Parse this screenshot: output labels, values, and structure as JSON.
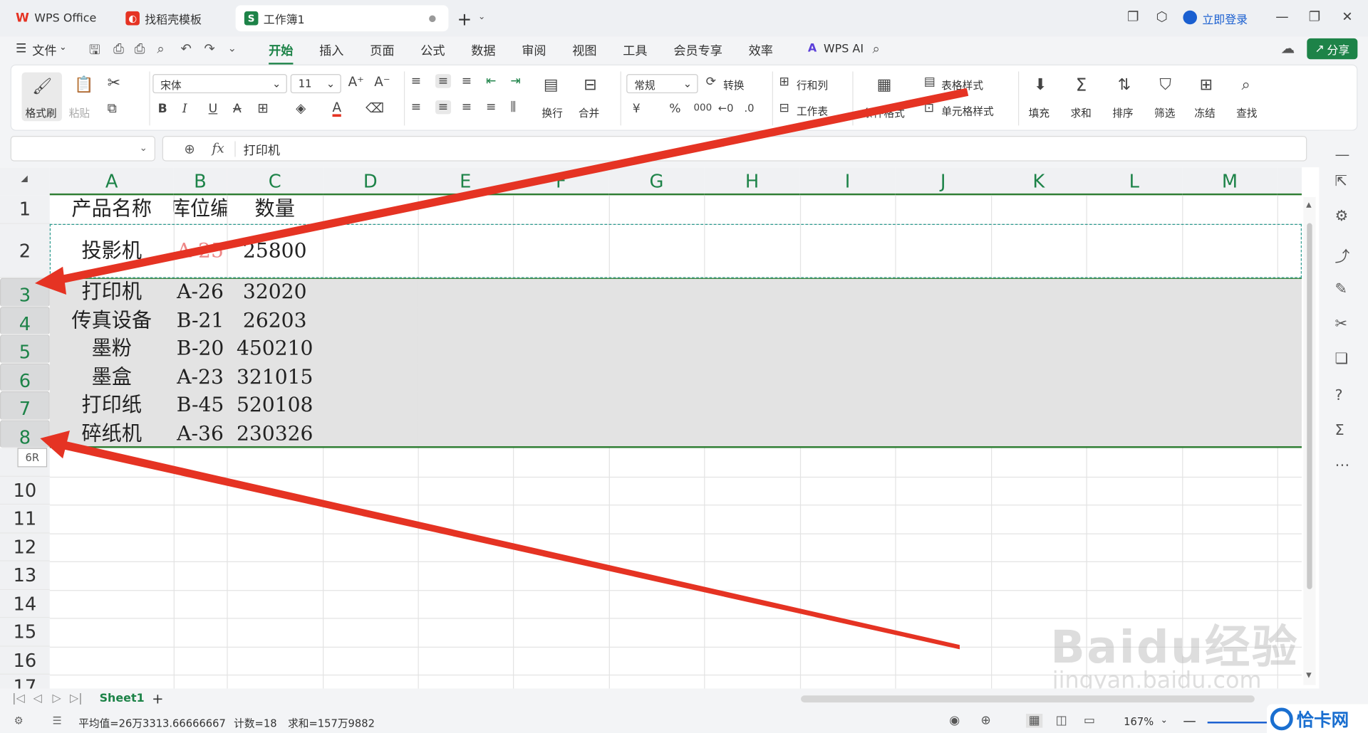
{
  "tabs": [
    {
      "label": "WPS Office",
      "icon": "wps-logo-icon"
    },
    {
      "label": "找稻壳模板",
      "icon": "docer-icon"
    },
    {
      "label": "工作簿1",
      "icon": "spreadsheet-s-icon",
      "badge": "S"
    }
  ],
  "top_right": {
    "login": "立即登录"
  },
  "menu": {
    "file": "文件",
    "items": [
      "开始",
      "插入",
      "页面",
      "公式",
      "数据",
      "审阅",
      "视图",
      "工具",
      "会员专享",
      "效率"
    ],
    "wps_ai": "WPS AI",
    "share": "分享"
  },
  "ribbon": {
    "format_painter": "格式刷",
    "paste": "粘贴",
    "font_name": "宋体",
    "font_size": "11",
    "wrap": "换行",
    "merge": "合并",
    "number_format": "常规",
    "convert": "转换",
    "row_col": "行和列",
    "worksheet": "工作表",
    "cond_format": "条件格式",
    "table_style": "表格样式",
    "cell_style": "单元格样式",
    "fill": "填充",
    "sum": "求和",
    "sort": "排序",
    "filter": "筛选",
    "freeze": "冻结",
    "find": "查找",
    "bold": "B",
    "italic": "I",
    "underline": "U",
    "strike": "A",
    "currency": "¥",
    "percent": "%",
    "thousands": "000"
  },
  "formula_bar": {
    "fx": "fx",
    "value": "打印机",
    "name_box": ""
  },
  "columns": [
    "A",
    "B",
    "C",
    "D",
    "E",
    "F",
    "G",
    "H",
    "I",
    "J",
    "K",
    "L",
    "M"
  ],
  "row_numbers": [
    "1",
    "2",
    "3",
    "4",
    "5",
    "6",
    "7",
    "8",
    "10",
    "11",
    "12",
    "13",
    "14",
    "15",
    "16",
    "17"
  ],
  "rows": [
    {
      "a": "产品名称",
      "b": "库位编",
      "c": "数量"
    },
    {
      "a": "投影机",
      "b": "A-25",
      "c": "25800"
    },
    {
      "a": "打印机",
      "b": "A-26",
      "c": "32020"
    },
    {
      "a": "传真设备",
      "b": "B-21",
      "c": "26203"
    },
    {
      "a": "墨粉",
      "b": "B-20",
      "c": "450210"
    },
    {
      "a": "墨盒",
      "b": "A-23",
      "c": "321015"
    },
    {
      "a": "打印纸",
      "b": "B-45",
      "c": "520108"
    },
    {
      "a": "碎纸机",
      "b": "A-36",
      "c": "230326"
    }
  ],
  "drag_tooltip": "6R",
  "sheet_tabs": {
    "active": "Sheet1",
    "add": "+"
  },
  "status": {
    "average": "平均值=26万3313.66666667",
    "count": "计数=18",
    "sum": "求和=157万9882",
    "zoom": "167%"
  },
  "watermark": {
    "brand": "Baidu经验",
    "url": "jingyan.baidu.com",
    "corner": "恰卡网"
  },
  "colors": {
    "accent": "#1d8348",
    "arrow": "#e53323",
    "selected_row": "#e2e2e2"
  }
}
